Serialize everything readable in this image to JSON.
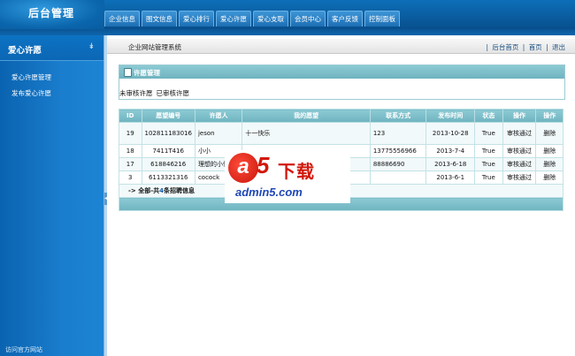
{
  "app": {
    "title": "后台管理"
  },
  "nav": {
    "tabs": [
      "企业信息",
      "图文信息",
      "爱心排行",
      "爱心许愿",
      "爱心支取",
      "会员中心",
      "客户反馈",
      "控制面板"
    ]
  },
  "sidebar": {
    "title": "爱心许愿",
    "items": [
      "爱心许愿管理",
      "发布爱心许愿"
    ],
    "footer": "访问官方网站"
  },
  "breadcrumb": {
    "title": "企业网站管理系统",
    "links": [
      "后台首页",
      "首页",
      "退出"
    ]
  },
  "panel": {
    "title": "许愿管理",
    "filters": [
      "未审核许愿",
      "已审核许愿"
    ]
  },
  "table": {
    "headers": [
      "ID",
      "愿望编号",
      "许愿人",
      "我的愿望",
      "联系方式",
      "发布时间",
      "状态",
      "操作",
      "操作"
    ],
    "rows": [
      {
        "id": "19",
        "code": "102811183016",
        "user": "jeson",
        "wish": "十一快乐",
        "contact": "123",
        "date": "2013-10-28",
        "status": "True",
        "op1": "审核通过",
        "op2": "删除"
      },
      {
        "id": "18",
        "code": "7411T416",
        "user": "小小",
        "wish": "",
        "contact": "13775556966",
        "date": "2013-7-4",
        "status": "True",
        "op1": "审核通过",
        "op2": "删除"
      },
      {
        "id": "17",
        "code": "618846216",
        "user": "理想的小储",
        "wish": "",
        "contact": "88886690",
        "date": "2013-6-18",
        "status": "True",
        "op1": "审核通过",
        "op2": "删除"
      },
      {
        "id": "3",
        "code": "6113321316",
        "user": "cocock",
        "wish": "",
        "contact": "",
        "date": "2013-6-1",
        "status": "True",
        "op1": "审核通过",
        "op2": "删除"
      }
    ],
    "summary_prefix": "-> 全部-共",
    "summary_count": "4",
    "summary_suffix": "条招聘信息"
  },
  "watermark": {
    "brand": "5",
    "brand_cn": "下载",
    "url": "admin5.com"
  },
  "colors": {
    "brand_blue": "#0b66ad",
    "panel_teal": "#7bbec9",
    "watermark_red": "#d2180c"
  }
}
